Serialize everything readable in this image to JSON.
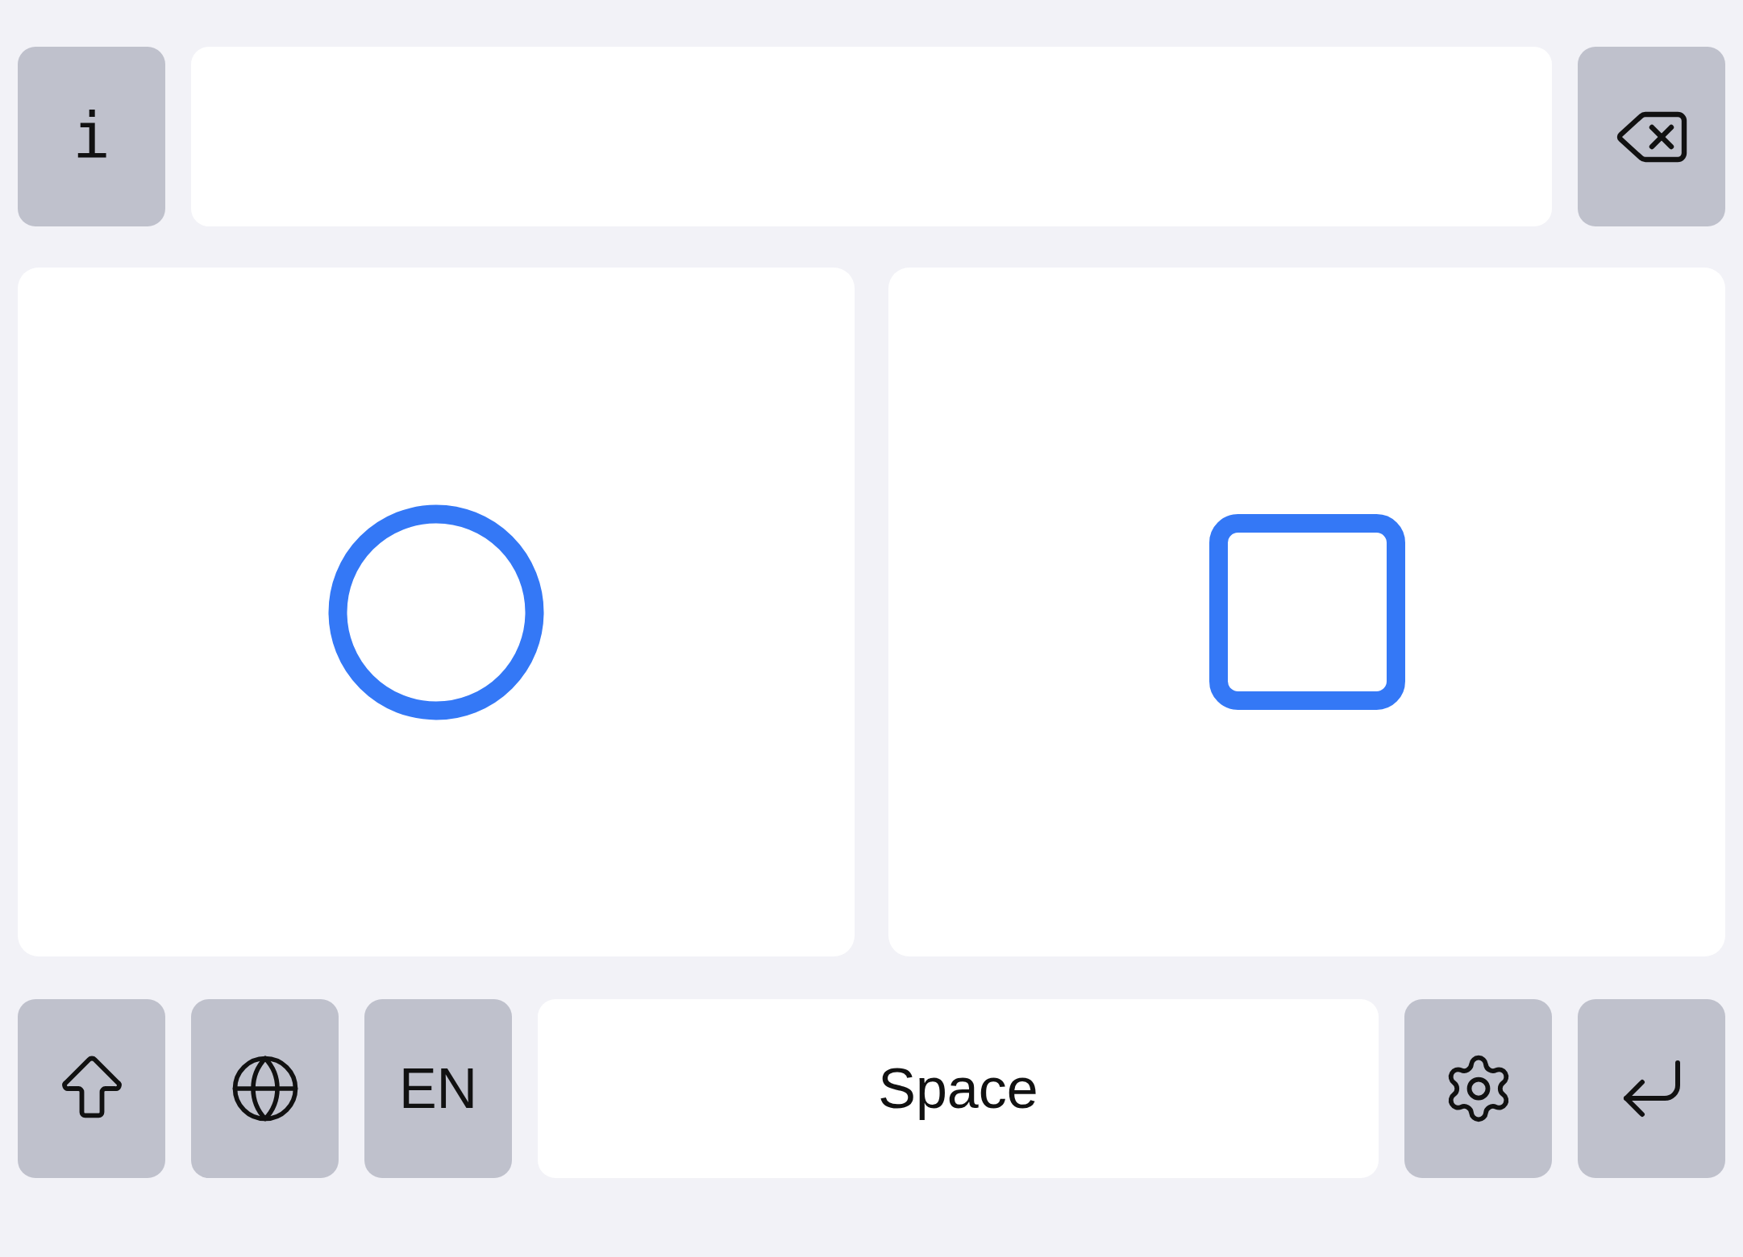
{
  "info_key": {
    "label": "i"
  },
  "panels": [
    {
      "kind": "circle"
    },
    {
      "kind": "square"
    }
  ],
  "bottom_row": {
    "language_key": "EN",
    "space_key": "Space"
  }
}
